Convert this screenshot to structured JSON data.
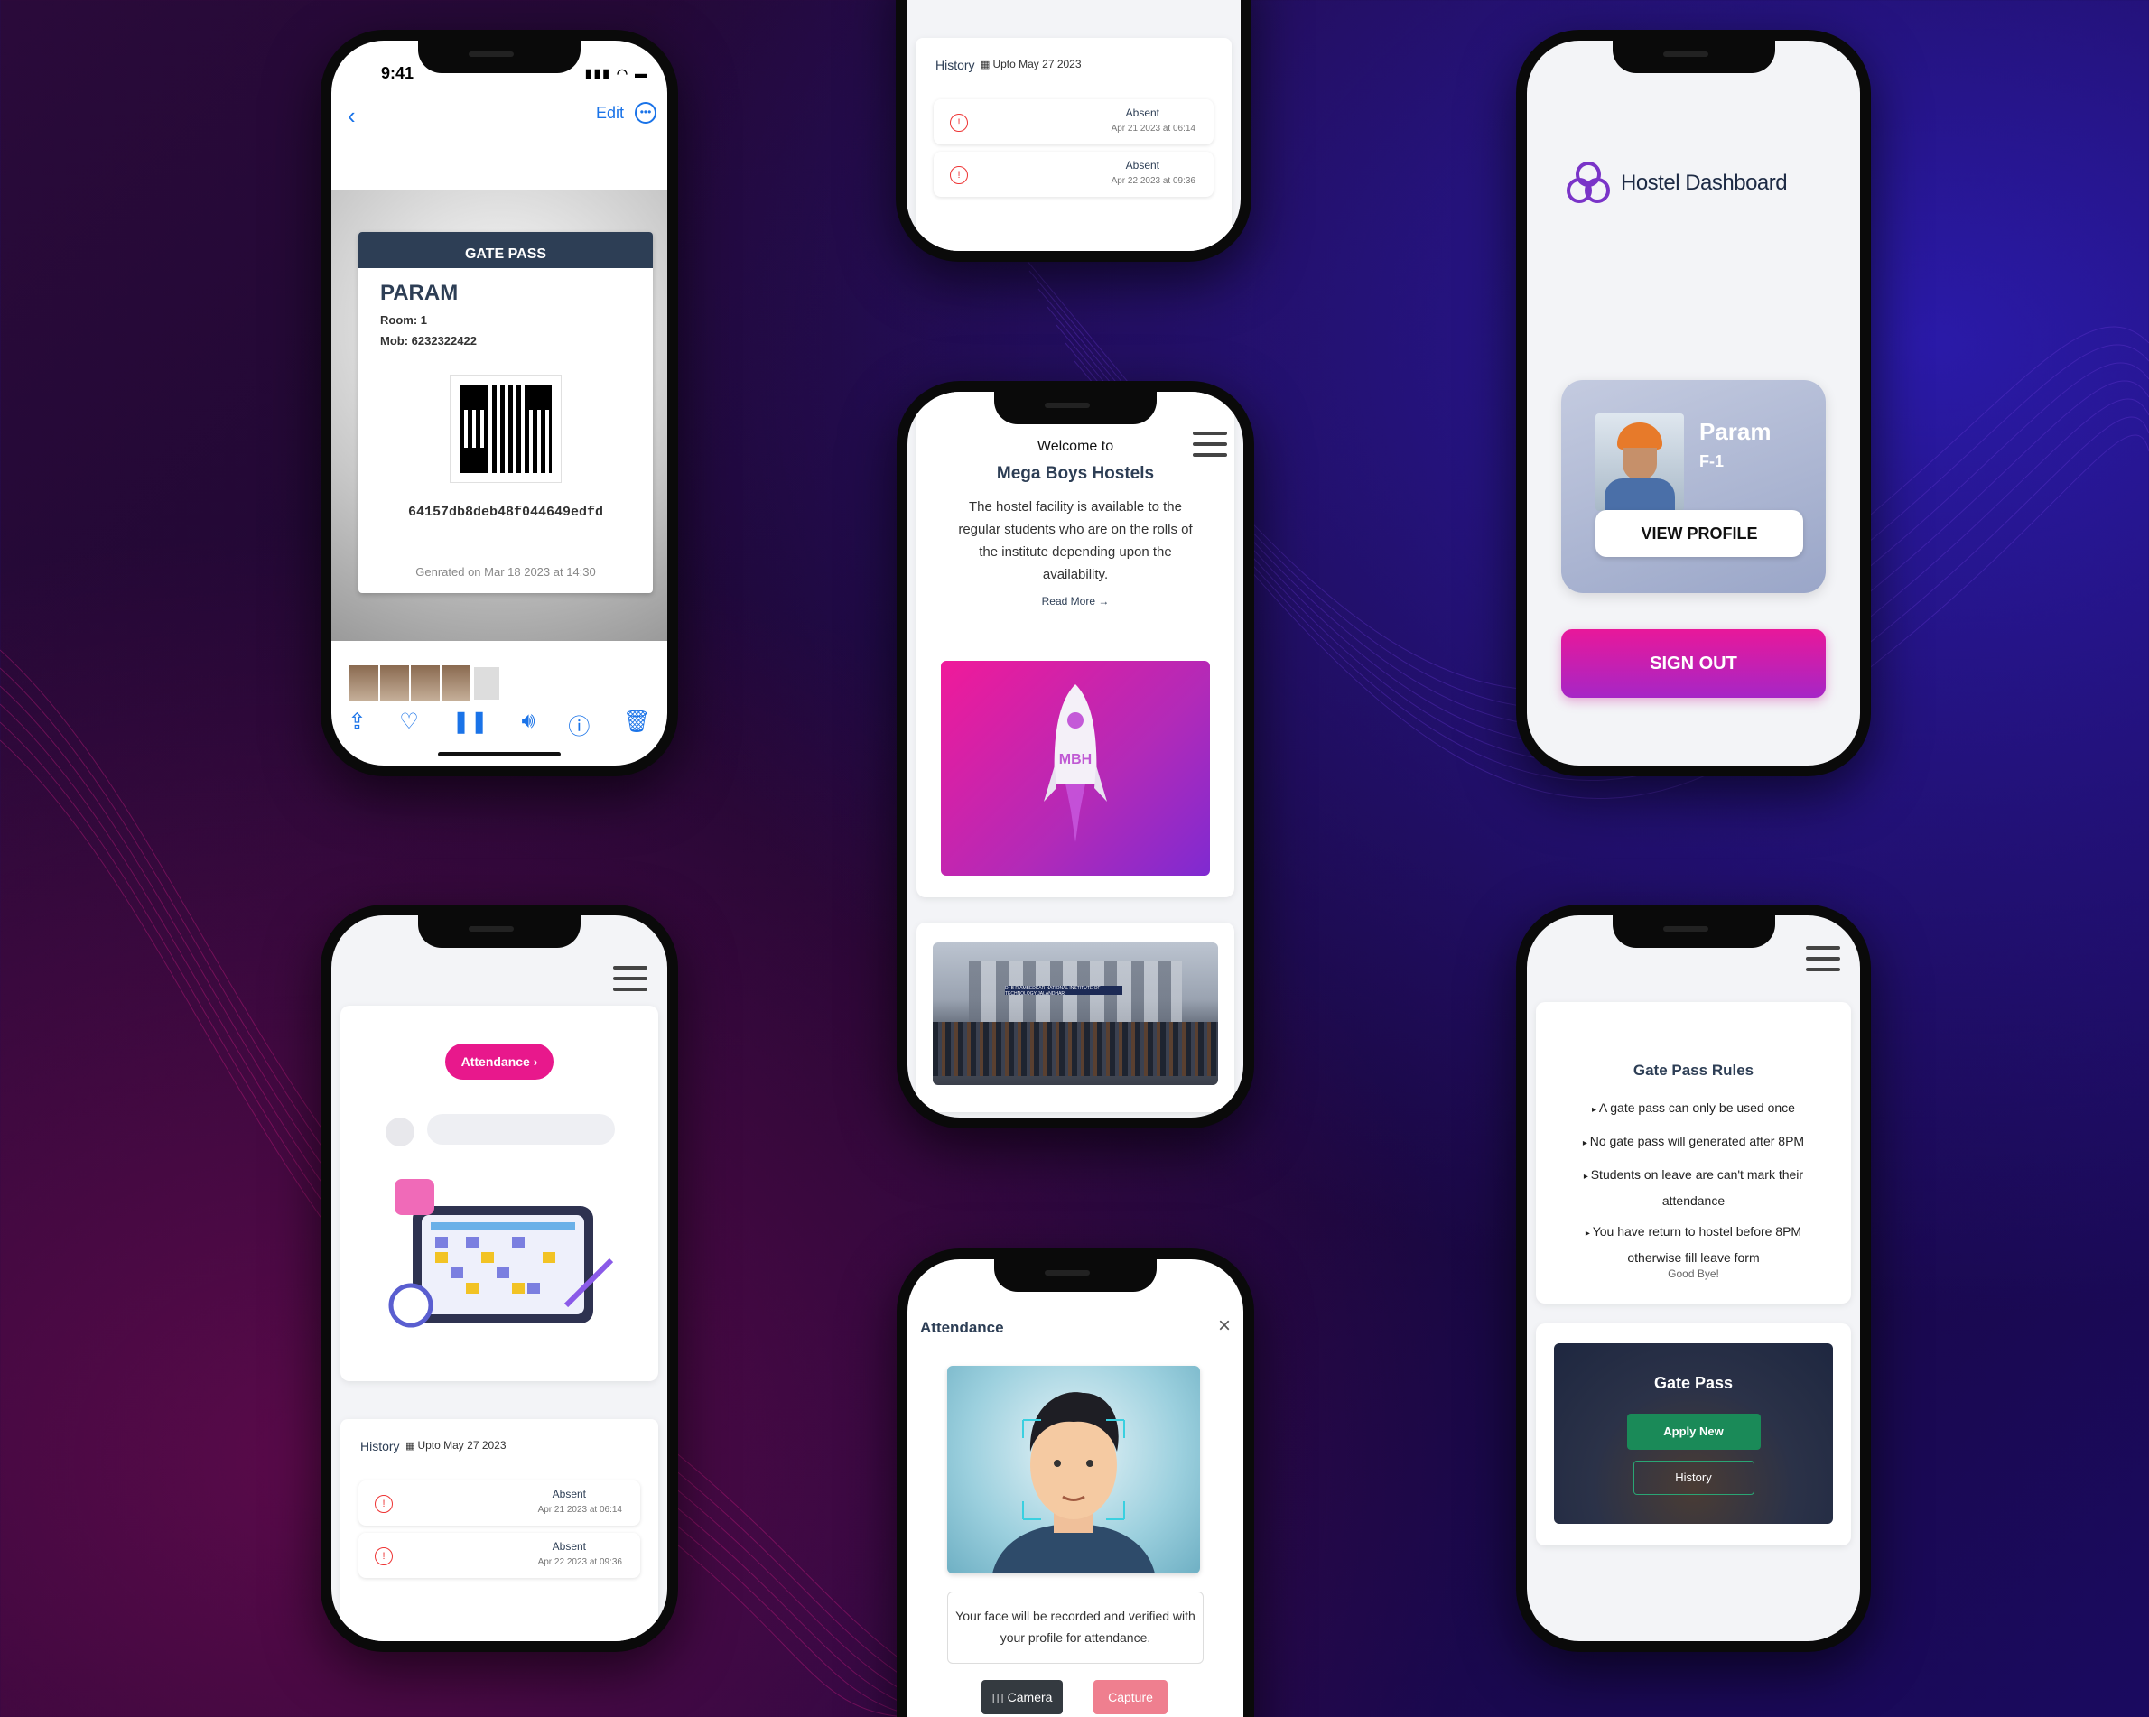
{
  "phone1": {
    "status_time": "9:41",
    "nav_edit": "Edit",
    "gate_pass_header": "GATE PASS",
    "name": "PARAM",
    "room": "Room: 1",
    "mob": "Mob: 6232322422",
    "code": "64157db8deb48f044649edfd",
    "generated": "Genrated on Mar 18 2023 at 14:30"
  },
  "history": {
    "title": "History",
    "upto": "Upto May 27 2023",
    "items": [
      {
        "status": "Absent",
        "date": "Apr 21 2023 at 06:14"
      },
      {
        "status": "Absent",
        "date": "Apr 22 2023 at 09:36"
      }
    ]
  },
  "welcome": {
    "welcome_to": "Welcome to",
    "hostel_name": "Mega Boys Hostels",
    "description": "The hostel facility is available to the regular students who are on the rolls of the institute depending upon the availability.",
    "read_more": "Read More →",
    "rocket_label": "MBH",
    "campus_banner": "Dr B R AMBEDKAR NATIONAL INSTITUTE OF TECHNOLOGY JALANDHAR"
  },
  "dashboard": {
    "title": "Hostel Dashboard",
    "profile_name": "Param",
    "profile_room": "F-1",
    "view_profile": "VIEW PROFILE",
    "sign_out": "SIGN OUT"
  },
  "attendance_page": {
    "pill": "Attendance"
  },
  "attendance_modal": {
    "title": "Attendance",
    "close": "×",
    "note": "Your face will be recorded and verified with your profile for attendance.",
    "camera_btn": "Camera",
    "capture_btn": "Capture"
  },
  "gate_rules": {
    "title": "Gate Pass Rules",
    "rules": [
      "A gate pass can only be used once",
      "No gate pass will generated after 8PM",
      "Students on leave are can't mark their attendance",
      "You have return to hostel before 8PM otherwise fill leave form"
    ],
    "goodbye": "Good Bye!",
    "gate_pass_title": "Gate Pass",
    "apply_new": "Apply New",
    "history_btn": "History"
  },
  "colors": {
    "accent_pink": "#e8188c",
    "navy": "#2d3e55",
    "green": "#1a8a58"
  }
}
